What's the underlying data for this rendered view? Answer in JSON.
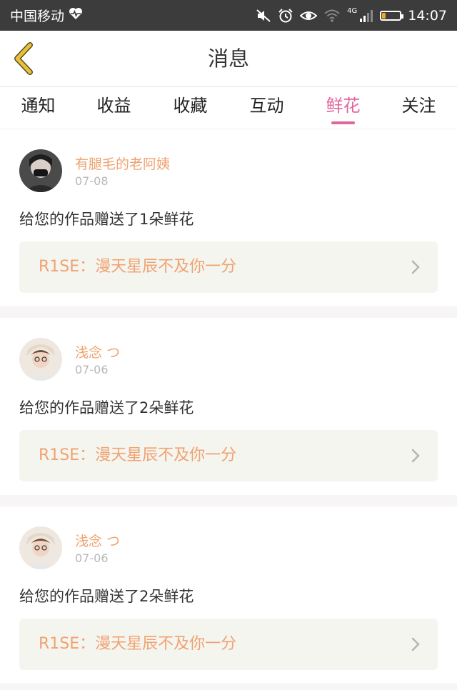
{
  "status_bar": {
    "carrier": "中国移动",
    "network": "4G",
    "time": "14:07",
    "battery_level": 0.2,
    "icons": [
      "heart-monitor-icon",
      "mute-icon",
      "alarm-icon",
      "eye-icon",
      "wifi-icon",
      "signal-icon",
      "battery-icon"
    ]
  },
  "header": {
    "title": "消息",
    "back_icon": "chevron-left-icon"
  },
  "tabs": [
    {
      "label": "通知",
      "active": false
    },
    {
      "label": "收益",
      "active": false
    },
    {
      "label": "收藏",
      "active": false
    },
    {
      "label": "互动",
      "active": false
    },
    {
      "label": "鲜花",
      "active": true
    },
    {
      "label": "关注",
      "active": false
    }
  ],
  "messages": [
    {
      "user": "有腿毛的老阿姨",
      "date": "07-08",
      "text": "给您的作品赠送了1朵鲜花",
      "work": "R1SE：漫天星辰不及你一分"
    },
    {
      "user": "浅念 つ",
      "date": "07-06",
      "text": "给您的作品赠送了2朵鲜花",
      "work": "R1SE：漫天星辰不及你一分"
    },
    {
      "user": "浅念 つ",
      "date": "07-06",
      "text": "给您的作品赠送了2朵鲜花",
      "work": "R1SE：漫天星辰不及你一分"
    }
  ],
  "colors": {
    "accent": "#e2659b",
    "username": "#f0a270",
    "back_arrow": "#e6c23b",
    "status_bar_bg": "#3c3c3c"
  }
}
